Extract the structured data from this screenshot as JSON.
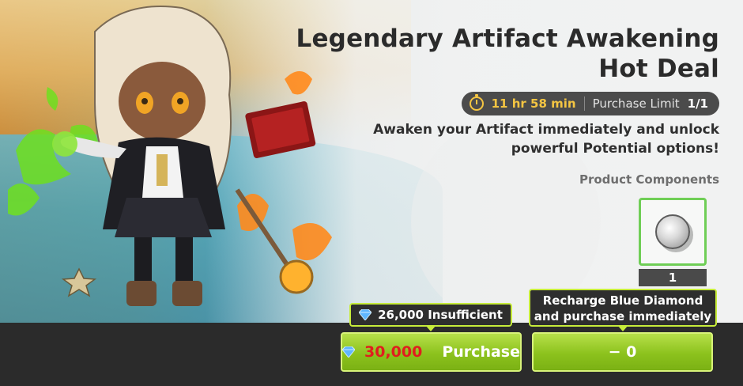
{
  "offer": {
    "title_line1": "Legendary Artifact Awakening",
    "title_line2": "Hot Deal",
    "timer": "11 hr 58 min",
    "purchase_limit_label": "Purchase Limit",
    "purchase_limit_value": "1/1",
    "description": "Awaken your Artifact immediately and unlock powerful Potential options!"
  },
  "components": {
    "label": "Product Components",
    "items": [
      {
        "icon": "silver-coin-icon",
        "quantity": "1"
      }
    ]
  },
  "purchase": {
    "balance_tooltip": "26,000 Insufficient",
    "price": "30,000",
    "button_label": "Purchase",
    "recharge_tooltip_line1": "Recharge Blue Diamond",
    "recharge_tooltip_line2": "and purchase immediately",
    "recharge_button_label": "− 0"
  },
  "colors": {
    "accent_green": "#8cc21d",
    "tooltip_border": "#c7ec3a",
    "timer_gold": "#f4c542",
    "price_red": "#e01e1e"
  }
}
